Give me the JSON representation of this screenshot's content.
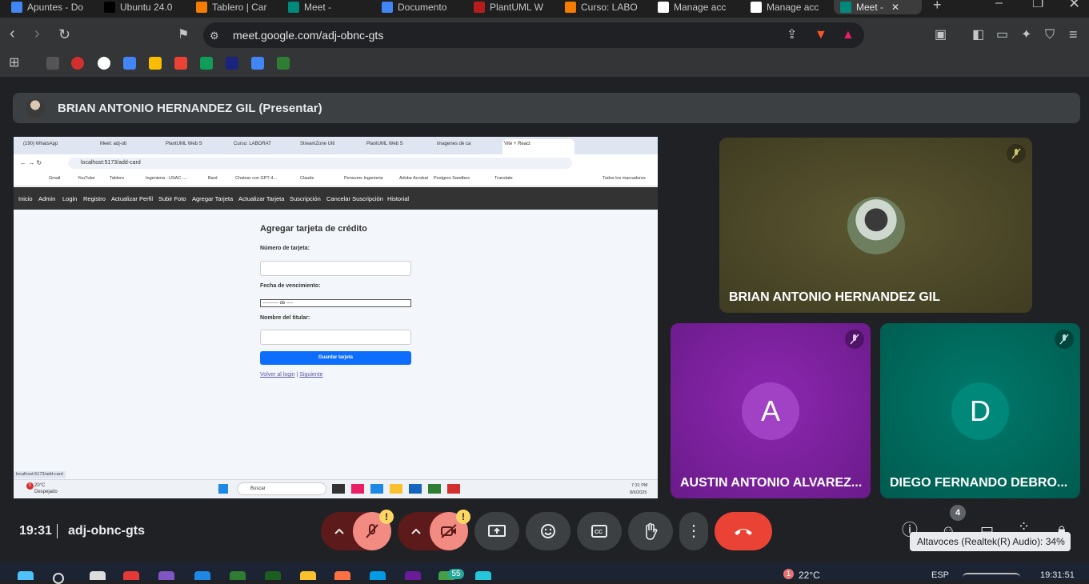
{
  "browser": {
    "tabs": [
      {
        "label": "Apuntes - Do",
        "color": "#4285f4"
      },
      {
        "label": "Ubuntu 24.0",
        "color": "#000000"
      },
      {
        "label": "Tablero | Car",
        "color": "#f57c00"
      },
      {
        "label": "Meet - ",
        "color": "#00897b"
      },
      {
        "label": "Documento",
        "color": "#4285f4"
      },
      {
        "label": "PlantUML W",
        "color": "#b71c1c"
      },
      {
        "label": "Curso: LABO",
        "color": "#f57c00"
      },
      {
        "label": "Manage acc",
        "color": "#ffffff"
      },
      {
        "label": "Manage acc",
        "color": "#ffffff"
      },
      {
        "label": "Meet - ",
        "color": "#00897b"
      }
    ],
    "url": "meet.google.com/adj-obnc-gts"
  },
  "presentation": {
    "title": "BRIAN ANTONIO HERNANDEZ GIL (Presentar)"
  },
  "shared_screen": {
    "tabs": [
      "(190) WhatsApp",
      "Meet: adj-ob",
      "PlantUML Web S",
      "Curso: LABORAT",
      "StreamZone Ulti",
      "PlantUML Web S",
      "imagenes de ca",
      "Vite + React"
    ],
    "url": "localhost:5173/add-card",
    "bookmarks": [
      "Gmail",
      "YouTube",
      "Tablero",
      "Ingenieria - USAC -...",
      "Bard",
      "Chatear con GPT-4...",
      "Claude",
      "Pensums Ingenieria",
      "Adobe Acrobat",
      "Postgres Sandbox",
      "Translate",
      "Todos los marcadores"
    ],
    "nav": [
      "Inicio",
      "Admin",
      "Login",
      "Registro",
      "Actualizar Perfil",
      "Subir Foto",
      "Agregar Tarjeta",
      "Actualizar Tarjeta",
      "Suscripción",
      "Cancelar Suscripción",
      "Historial"
    ],
    "form": {
      "title": "Agregar tarjeta de crédito",
      "card_label": "Número de tarjeta:",
      "expiry_label": "Fecha de vencimiento:",
      "expiry_value": "---------- de ----",
      "holder_label": "Nombre del titular:",
      "save": "Guardar tarjeta",
      "back_link": "Volver al login",
      "link_sep": "|",
      "next_link": "Siguiente"
    },
    "status_url": "localhost:5173/add-card",
    "taskbar": {
      "weather_temp": "20°C",
      "weather_desc": "Despejado",
      "weather_badge": "5",
      "search": "Buscar",
      "time": "7:31 PM",
      "date": "8/6/2025"
    }
  },
  "participants": [
    {
      "name": "BRIAN ANTONIO HERNANDEZ GIL",
      "bg": "#4a4726"
    },
    {
      "name": "AUSTIN ANTONIO ALVAREZ...",
      "initial": "A",
      "bg": "#7b1fa2",
      "avatar": "#a142c4"
    },
    {
      "name": "DIEGO FERNANDO DEBRO...",
      "initial": "D",
      "bg": "#00695c",
      "avatar": "#00897b"
    }
  ],
  "meeting": {
    "time": "19:31",
    "code": "adj-obnc-gts",
    "people_count": "4",
    "volume_tooltip": "Altavoces (Realtek(R) Audio): 34%",
    "warn": "!",
    "accent_red": "#ea4335",
    "mute_red": "#f28b82"
  },
  "os_taskbar": {
    "notif_count": "55",
    "weather_badge": "1",
    "temp": "22°C",
    "lang": "ESP",
    "time": "19:31:51"
  }
}
